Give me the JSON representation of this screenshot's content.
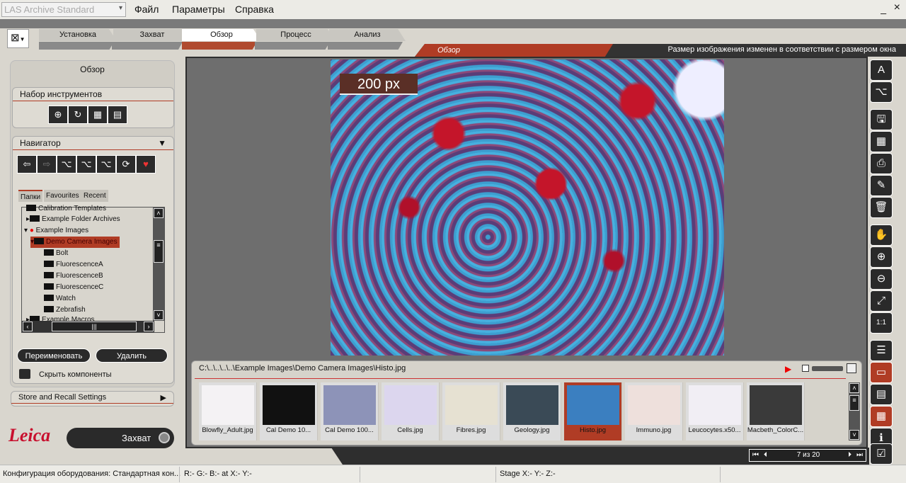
{
  "app": {
    "title": "LAS Archive Standard"
  },
  "menu": [
    "Файл",
    "Параметры",
    "Справка"
  ],
  "workflow_tabs": [
    {
      "label": "Установка"
    },
    {
      "label": "Захват"
    },
    {
      "label": "Обзор",
      "active": true
    },
    {
      "label": "Процесс"
    },
    {
      "label": "Анализ"
    }
  ],
  "view_bar": {
    "title": "Обзор",
    "message": "Размер изображения изменен в соответствии с размером окна"
  },
  "left_panel": {
    "title": "Обзор",
    "toolset_title": "Набор инструментов",
    "navigator_title": "Навигатор",
    "nav_tabs": [
      "Папки",
      "Favourites",
      "Recent"
    ],
    "tree": [
      {
        "label": "Calibration Templates",
        "level": 0
      },
      {
        "label": "Example Folder Archives",
        "level": 0
      },
      {
        "label": "Example Images",
        "level": 0
      },
      {
        "label": "Demo Camera Images",
        "level": 1,
        "selected": true
      },
      {
        "label": "Bolt",
        "level": 2
      },
      {
        "label": "FluorescenceA",
        "level": 2
      },
      {
        "label": "FluorescenceB",
        "level": 2
      },
      {
        "label": "FluorescenceC",
        "level": 2
      },
      {
        "label": "Watch",
        "level": 2
      },
      {
        "label": "Zebrafish",
        "level": 2
      },
      {
        "label": "Example Macros",
        "level": 0
      }
    ],
    "rename_label": "Переименовать",
    "delete_label": "Удалить",
    "hide_components_label": "Скрыть компоненты",
    "store_recall_label": "Store and Recall Settings"
  },
  "brand": "Leica",
  "capture_label": "Захват",
  "image": {
    "scale_label": "200 px"
  },
  "gallery": {
    "path": "C:\\..\\..\\..\\..\\Example Images\\Demo Camera Images\\Histo.jpg",
    "items": [
      {
        "label": "Blowfly_Adult.jpg",
        "color": "#f4f2f4"
      },
      {
        "label": "Cal Demo 10...",
        "color": "#111111"
      },
      {
        "label": "Cal Demo 100...",
        "color": "#8d93b8"
      },
      {
        "label": "Cells.jpg",
        "color": "#dcd6ee"
      },
      {
        "label": "Fibres.jpg",
        "color": "#e6e1d2"
      },
      {
        "label": "Geology.jpg",
        "color": "#3a4a56"
      },
      {
        "label": "Histo.jpg",
        "color": "#3b7fc0",
        "selected": true
      },
      {
        "label": "Immuno.jpg",
        "color": "#eee0dc"
      },
      {
        "label": "Leucocytes.x50...",
        "color": "#f1eef4"
      },
      {
        "label": "Macbeth_ColorC...",
        "color": "#3a3a3a"
      }
    ]
  },
  "pager": {
    "text": "7 из 20"
  },
  "status": {
    "config": "Конфигурация оборудования:  Стандартная кон...",
    "rgb": "R:-  G:-  B:-  at  X:-  Y:-",
    "stage": "Stage X:-  Y:-  Z:-"
  },
  "colors": {
    "accent": "#b03c25",
    "dark": "#2a2a2a"
  }
}
